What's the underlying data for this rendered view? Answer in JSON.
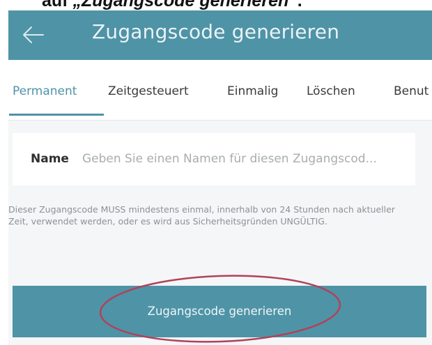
{
  "doc_caption": {
    "prefix": "auf ",
    "quoted": "„Zugangscode generieren“",
    "suffix": "."
  },
  "header": {
    "title": "Zugangscode generieren",
    "back_icon": "arrow-left-icon"
  },
  "tabs": [
    {
      "label": "Permanent",
      "active": true
    },
    {
      "label": "Zeitgesteuert",
      "active": false
    },
    {
      "label": "Einmalig",
      "active": false
    },
    {
      "label": "Löschen",
      "active": false
    },
    {
      "label": "Benut",
      "active": false
    }
  ],
  "form": {
    "name_label": "Name",
    "name_placeholder": "Geben Sie einen Namen für diesen Zugangscod...",
    "name_value": ""
  },
  "hint_text": "Dieser Zugangscode MUSS mindestens einmal, innerhalb von 24 Stunden nach aktueller Zeit, verwendet werden, oder es wird aus Sicherheitsgründen UNGÜLTIG.",
  "actions": {
    "generate_label": "Zugangscode generieren"
  },
  "colors": {
    "accent": "#4f93a6",
    "highlight_oval": "#b0425a",
    "hint_text": "#8d9295",
    "background": "#f4f6f7"
  }
}
